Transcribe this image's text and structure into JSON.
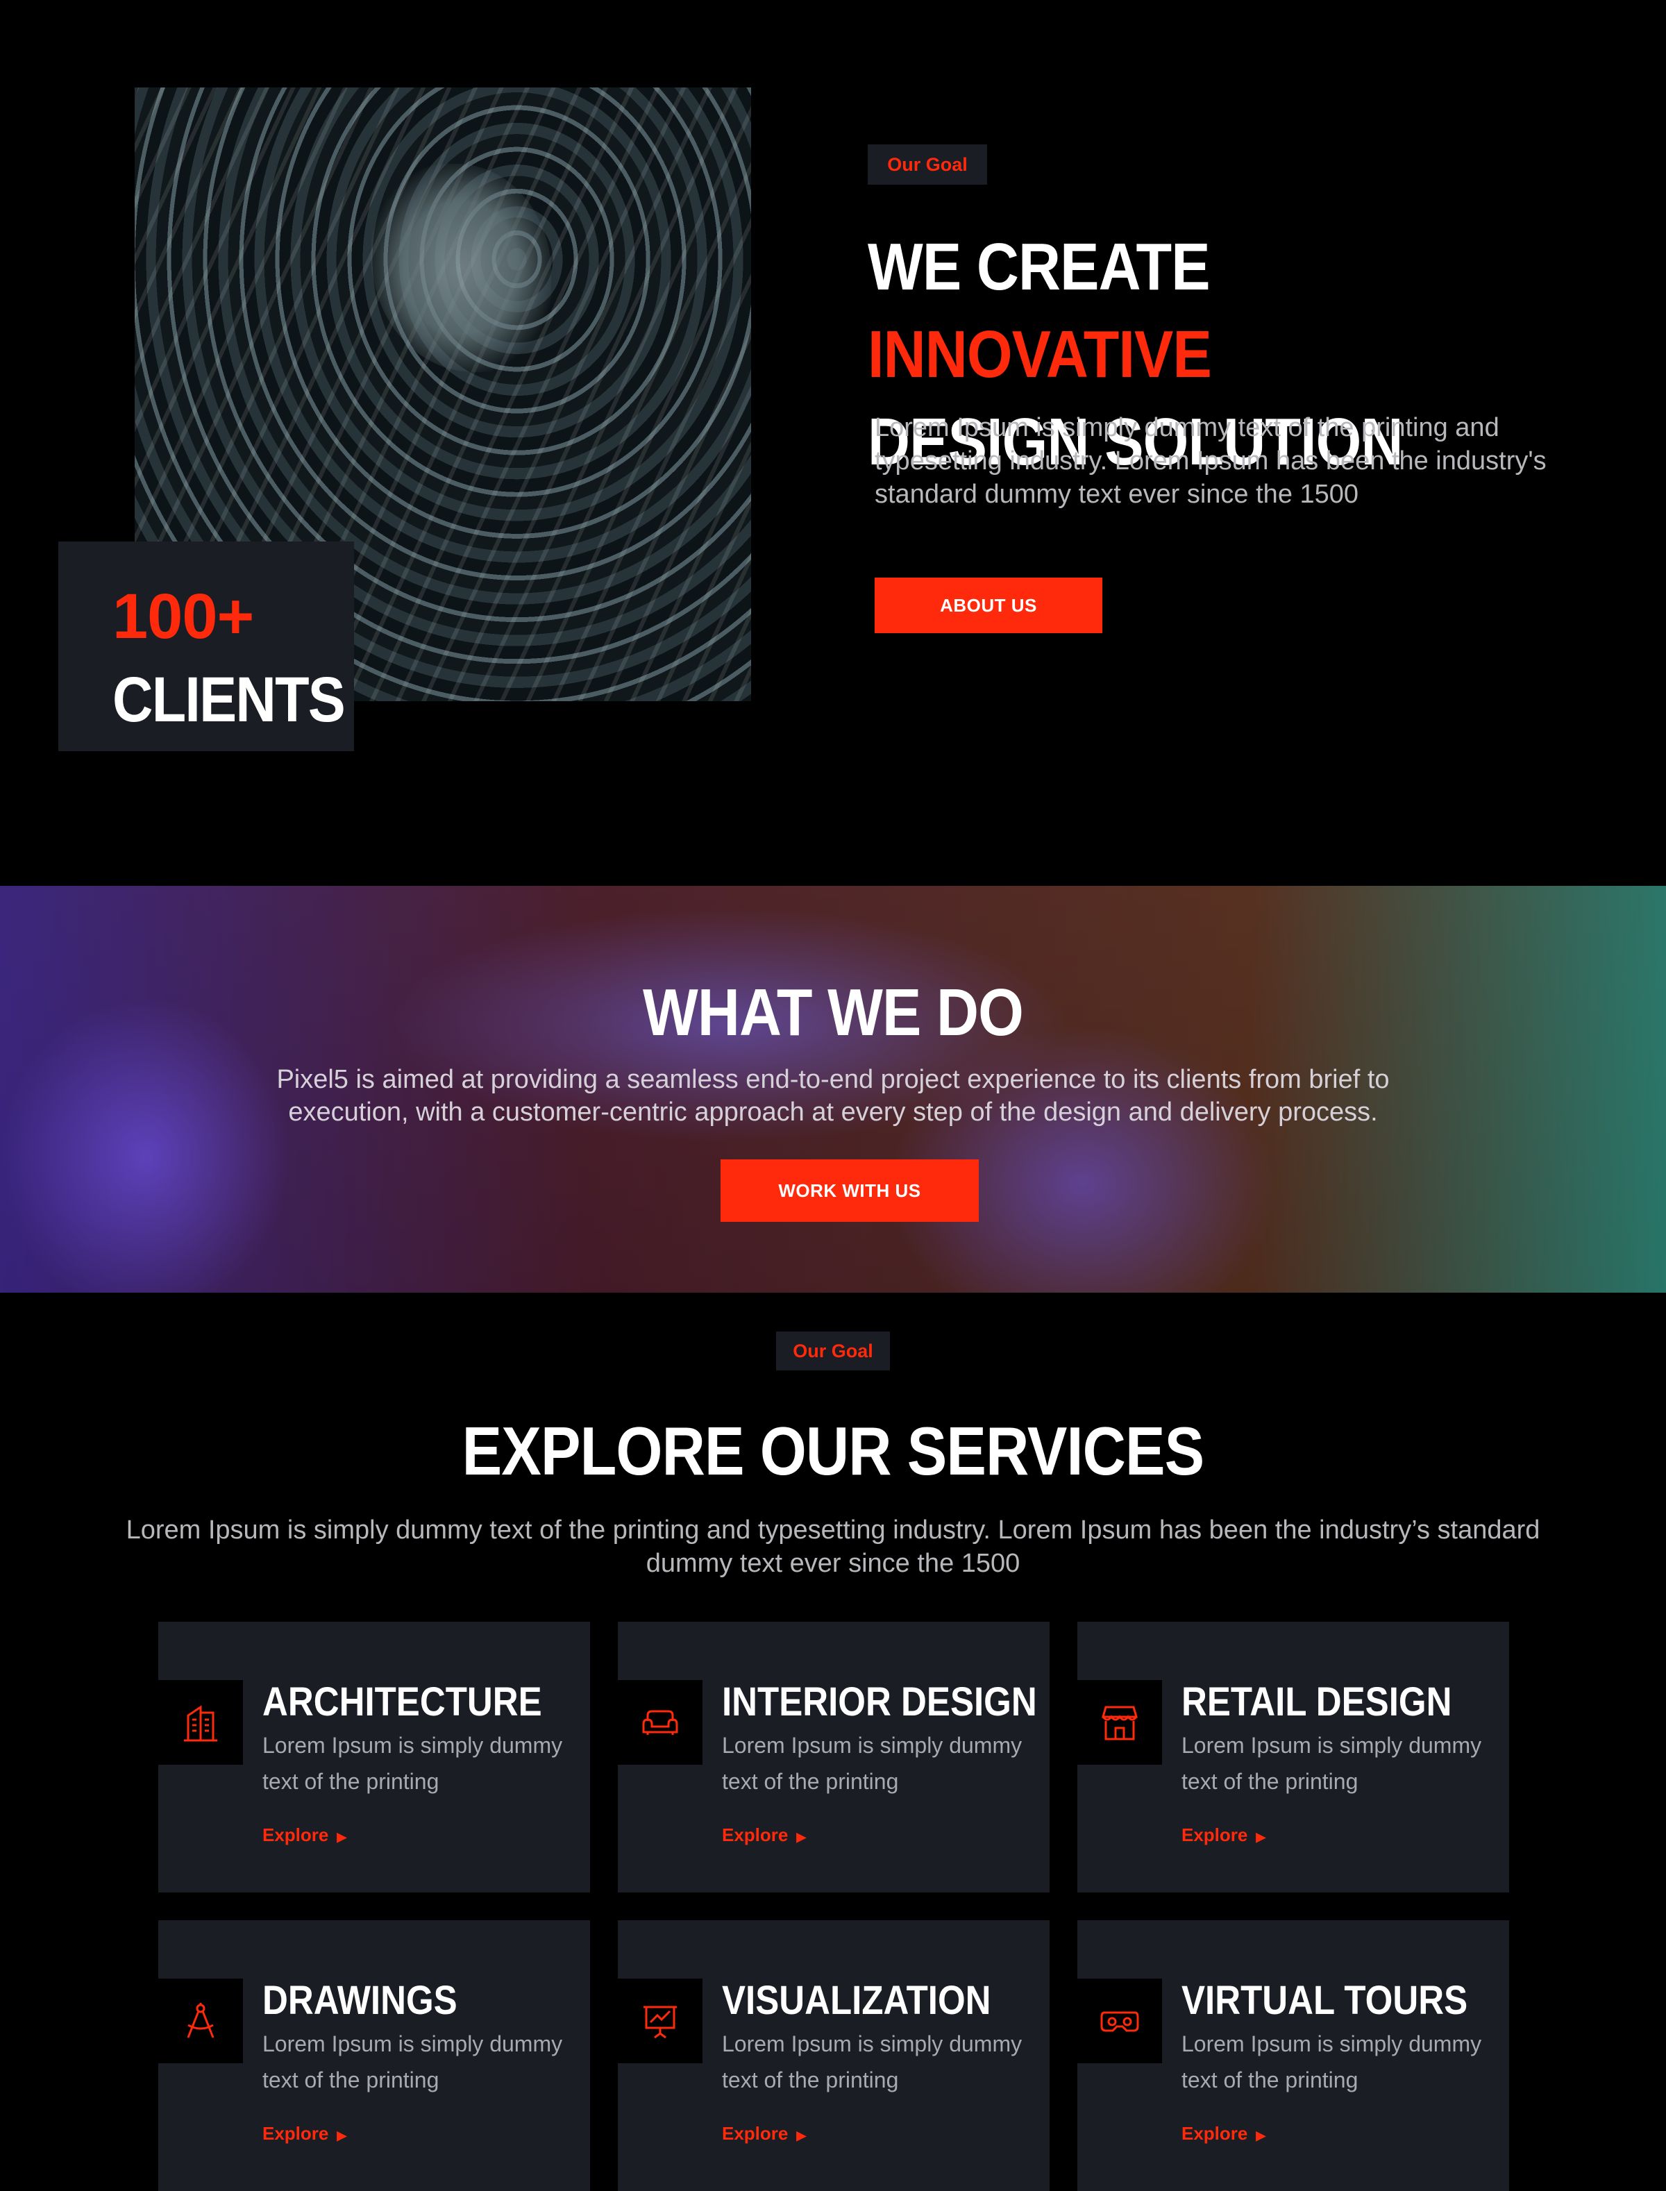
{
  "goal": {
    "tag": "Our Goal",
    "title_white": "WE CREATE ",
    "title_accent": "INNOVATIVE",
    "title_line2": "DESIGN SOLUTION",
    "text": "Lorem Ipsum is simply dummy text of the printing and typesetting industry. Lorem Ipsum has been the industry's standard dummy text ever since the 1500",
    "button": "ABOUT US"
  },
  "stats": {
    "number": "100+",
    "label": "CLIENTS"
  },
  "what_we_do": {
    "title": "WHAT WE DO",
    "text": "Pixel5 is aimed at providing a seamless end-to-end project experience to its clients from brief to execution, with a customer-centric approach at every step of the design and delivery process.",
    "button": "WORK WITH US"
  },
  "services": {
    "tag": "Our Goal",
    "title": "EXPLORE OUR SERVICES",
    "text": "Lorem Ipsum is simply dummy text of the printing and typesetting industry. Lorem Ipsum has been the industry’s standard dummy text ever since the 1500",
    "cards": [
      {
        "title": "ARCHITECTURE",
        "text": "Lorem Ipsum is simply dummy text of the printing",
        "link": "Explore",
        "icon": "building-icon"
      },
      {
        "title": "INTERIOR DESIGN",
        "text": "Lorem Ipsum is simply dummy text of the printing",
        "link": "Explore",
        "icon": "sofa-icon"
      },
      {
        "title": "RETAIL DESIGN",
        "text": "Lorem Ipsum is simply dummy text of the printing",
        "link": "Explore",
        "icon": "storefront-icon"
      },
      {
        "title": "DRAWINGS",
        "text": "Lorem Ipsum is simply dummy text of the printing",
        "link": "Explore",
        "icon": "compass-icon"
      },
      {
        "title": "VISUALIZATION",
        "text": "Lorem Ipsum is simply dummy text of the printing",
        "link": "Explore",
        "icon": "presentation-icon"
      },
      {
        "title": "VIRTUAL TOURS",
        "text": "Lorem Ipsum is simply dummy text of the printing",
        "link": "Explore",
        "icon": "vr-headset-icon"
      }
    ]
  },
  "colors": {
    "accent": "#ff2a0c",
    "background": "#000000",
    "card": "#1b1d24"
  }
}
